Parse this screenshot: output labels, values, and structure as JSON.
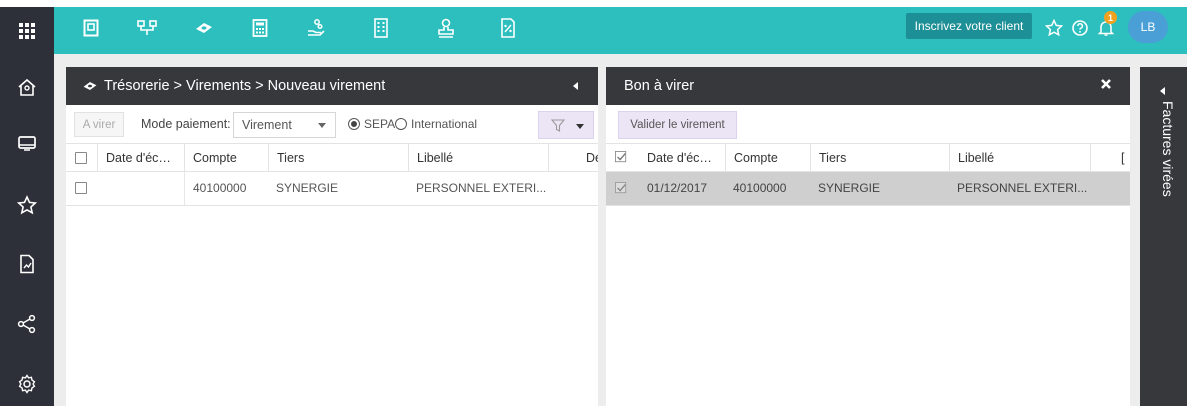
{
  "topbar": {
    "register_button": "Inscrivez votre client",
    "notification_count": "1",
    "user_initials": "LB",
    "icons": [
      "document-icon",
      "hierarchy-icon",
      "money-icon",
      "calculator-icon",
      "hand-coin-icon",
      "building-icon",
      "stamp-icon",
      "percent-doc-icon"
    ]
  },
  "leftnav": {
    "icons": [
      "home-icon",
      "monitor-icon",
      "star-icon",
      "chart-doc-icon",
      "share-icon",
      "settings-icon"
    ]
  },
  "left_panel": {
    "breadcrumb": "Trésorerie > Virements > Nouveau virement",
    "a_virer_button": "A virer",
    "mode_label": "Mode paiement:",
    "mode_value": "Virement",
    "radio_sepa": "SEPA",
    "radio_international": "International",
    "columns": [
      "Date d'éc…",
      "Compte",
      "Tiers",
      "Libellé",
      "Dé"
    ],
    "rows": [
      {
        "date": "",
        "compte": "40100000",
        "tiers": "SYNERGIE",
        "libelle": "PERSONNEL EXTERI..."
      }
    ]
  },
  "right_panel": {
    "title": "Bon à virer",
    "valider_button": "Valider le virement",
    "columns": [
      "Date d'éc…",
      "Compte",
      "Tiers",
      "Libellé",
      "["
    ],
    "rows": [
      {
        "date": "01/12/2017",
        "compte": "40100000",
        "tiers": "SYNERGIE",
        "libelle": "PERSONNEL EXTERI..."
      }
    ]
  },
  "side_tab": {
    "label": "Factures virées"
  },
  "colors": {
    "topbar": "#2cbfbd",
    "dark": "#2e3039",
    "panel_header": "#36383c",
    "accent_button": "#1d8f96",
    "selected_row": "#cfcfcf",
    "badge": "#f2a11f",
    "avatar": "#4a9fd6"
  }
}
